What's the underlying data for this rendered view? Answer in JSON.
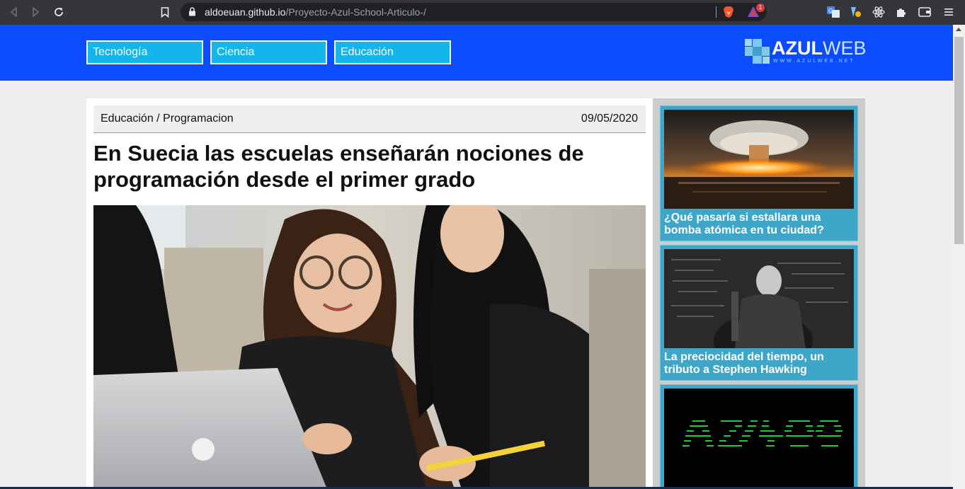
{
  "browser": {
    "url_host": "aldoeuan.github.io",
    "url_path": "/Proyecto-Azul-School-Articulo-/",
    "rewards_badge": "1",
    "icons": [
      "back-icon",
      "forward-icon",
      "reload-icon",
      "bookmark-icon",
      "lock-icon",
      "brave-shields-icon",
      "brave-rewards-icon",
      "translate-icon",
      "extension-icon",
      "react-devtools-icon",
      "extensions-puzzle-icon",
      "wallet-icon",
      "menu-icon"
    ]
  },
  "site": {
    "nav": [
      "Tecnología",
      "Ciencia",
      "Educación"
    ],
    "logo_bold": "AZUL",
    "logo_light": "WEB",
    "logo_sub": "WWW.AZULWEB.NET",
    "brand_color": "#0b4cff",
    "tab_color": "#13b5ea"
  },
  "article": {
    "category": "Educación / Programacion",
    "date": "09/05/2020",
    "title": "En Suecia las escuelas enseñarán nociones de programación desde el primer grado"
  },
  "sidebar": {
    "cards": [
      {
        "title": "¿Qué pasaría si estallara una bomba atómica en tu ciudad?"
      },
      {
        "title": "La preciocidad del tiempo, un tributo a Stephen Hawking"
      },
      {
        "title": ""
      }
    ],
    "card_color": "#3ea6c9"
  }
}
